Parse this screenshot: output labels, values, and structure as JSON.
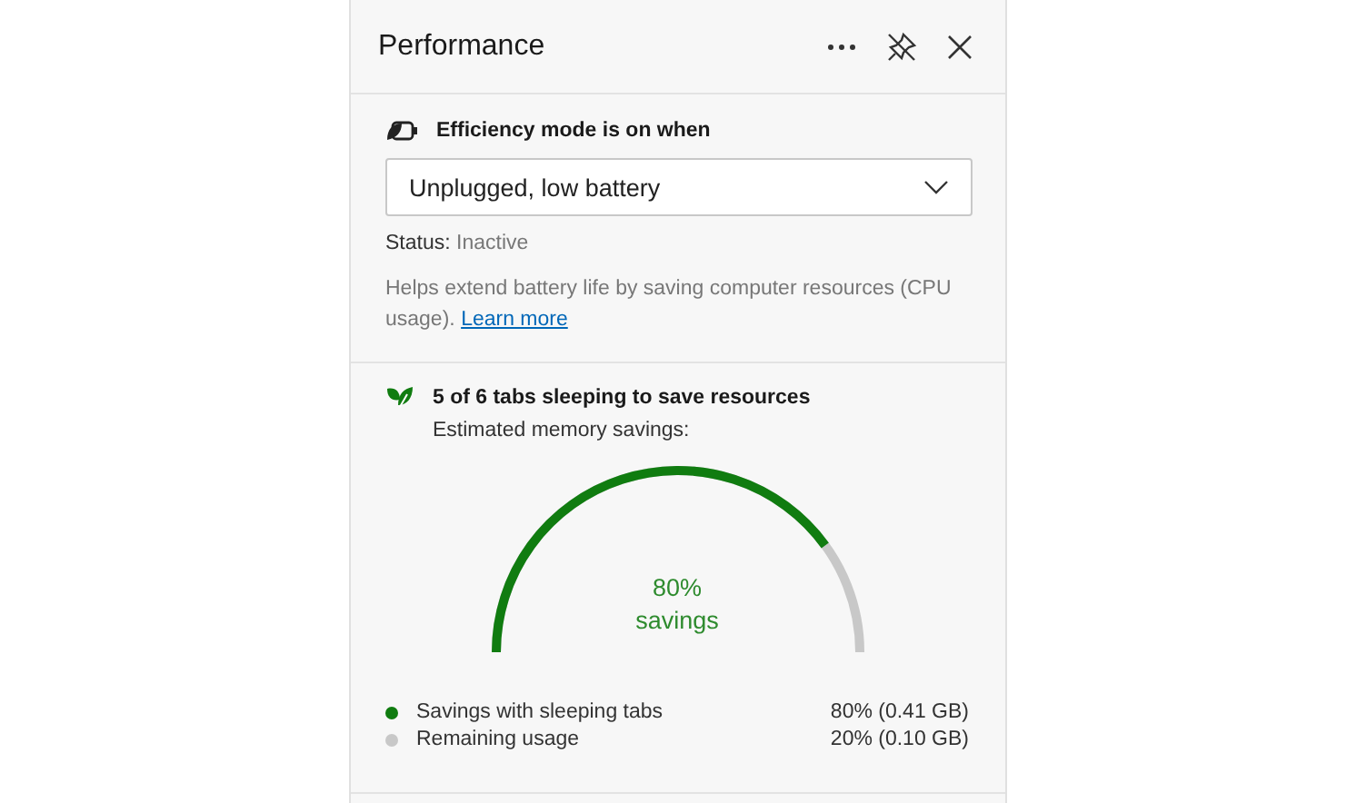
{
  "panel": {
    "title": "Performance"
  },
  "efficiency": {
    "label": "Efficiency mode is on when",
    "dropdown": {
      "value": "Unplugged, low battery"
    },
    "status_label": "Status:",
    "status_value": "Inactive",
    "description": "Helps extend battery life by saving computer resources (CPU usage).",
    "link": "Learn more"
  },
  "sleeping": {
    "heading": "5 of 6 tabs sleeping to save resources",
    "subheading": "Estimated memory savings:",
    "gauge": {
      "percent": "80%",
      "caption": "savings"
    },
    "legend": [
      {
        "label": "Savings with sleeping tabs",
        "value": "80% (0.41 GB)",
        "color": "#107c10"
      },
      {
        "label": "Remaining usage",
        "value": "20% (0.10 GB)",
        "color": "#c8c8c8"
      }
    ]
  }
}
